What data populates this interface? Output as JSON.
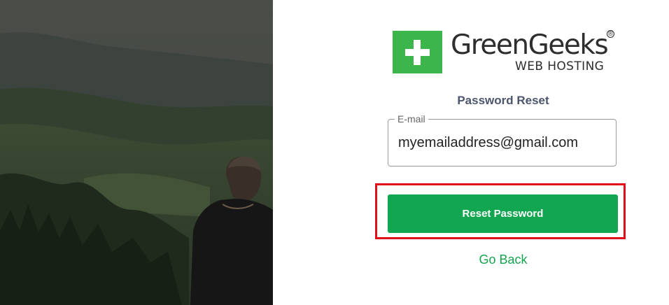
{
  "brand": {
    "name": "GreenGeeks",
    "registered_mark": "®",
    "tagline": "WEB HOSTING",
    "logo_icon": "plus-icon",
    "colors": {
      "logo_green": "#3cb54a",
      "button_green": "#13a650",
      "link_green": "#16a34e",
      "highlight_red": "#e0101a"
    }
  },
  "form": {
    "title": "Password Reset",
    "email": {
      "label": "E-mail",
      "value": "myemailaddress@gmail.com"
    },
    "submit_label": "Reset Password",
    "back_link": "Go Back"
  },
  "hero": {
    "image": "forest-mountain-landscape-with-man"
  }
}
